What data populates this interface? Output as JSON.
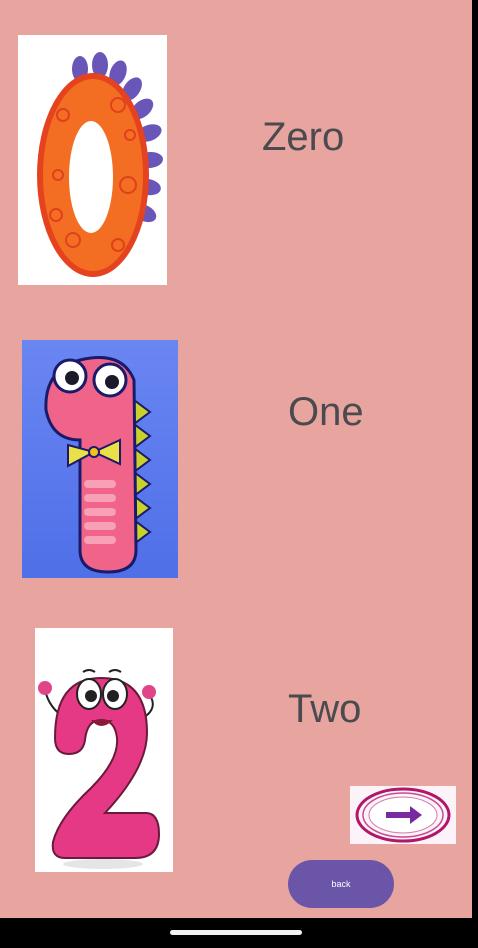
{
  "numbers": [
    {
      "label": "Zero",
      "image": "zero-character-icon"
    },
    {
      "label": "One",
      "image": "one-character-icon"
    },
    {
      "label": "Two",
      "image": "two-character-icon"
    }
  ],
  "next_button": {
    "icon": "right-arrow-icon"
  },
  "back_button": {
    "label": "back"
  },
  "colors": {
    "background": "#e8a59f",
    "button": "#6a55a8",
    "label_text": "#4a4a4f"
  }
}
